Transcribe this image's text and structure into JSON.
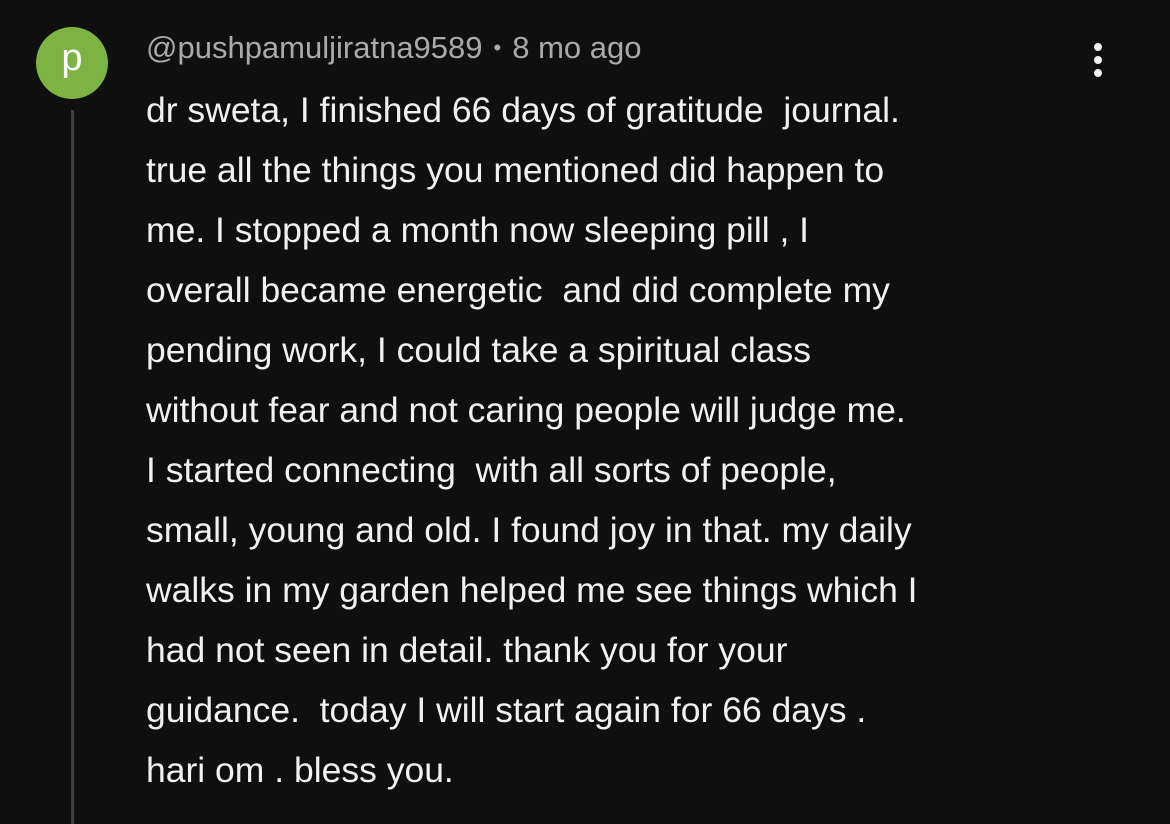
{
  "comment": {
    "avatar_letter": "p",
    "avatar_color": "#7cb342",
    "author": "@pushpamuljiratna9589",
    "separator": "•",
    "timestamp": "8 mo ago",
    "menu_icon": "more-vertical-icon",
    "lines": [
      "dr sweta, I finished 66 days of gratitude  journal.",
      "true all the things you mentioned did happen to",
      "me. I stopped a month now sleeping pill , I",
      "overall became energetic  and did complete my",
      "pending work, I could take a spiritual class",
      "without fear and not caring people will judge me.",
      "I started connecting  with all sorts of people,",
      "small, young and old. I found joy in that. my daily",
      "walks in my garden helped me see things which I",
      "had not seen in detail. thank you for your",
      "guidance.  today I will start again for 66 days .",
      "hari om . bless you."
    ]
  },
  "colors": {
    "background": "#0f0f0f",
    "text": "#f1f1f1",
    "meta_text": "#aaaaaa",
    "thread_line": "#3f3f3f"
  }
}
